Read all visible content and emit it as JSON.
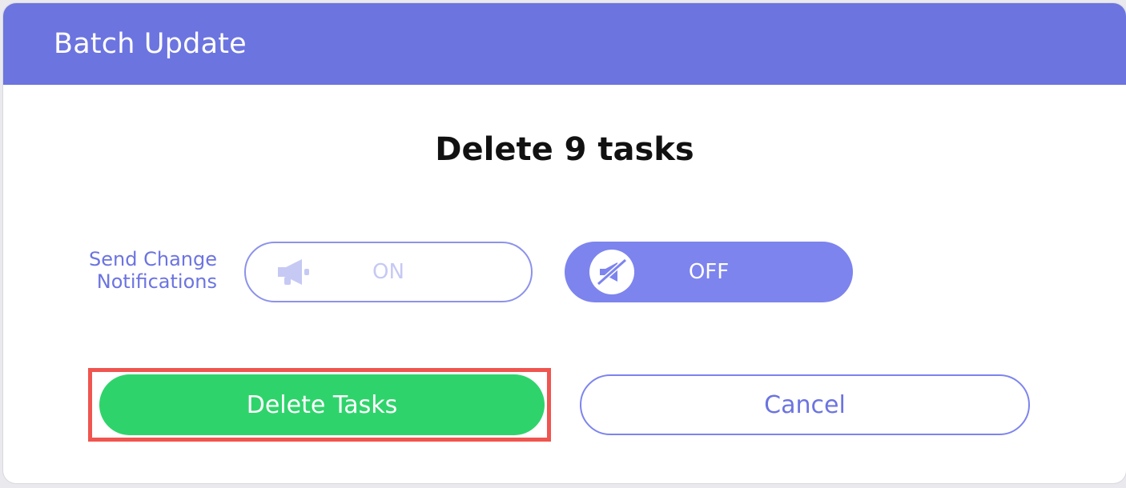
{
  "dialog": {
    "title": "Batch Update",
    "heading": "Delete 9 tasks"
  },
  "notifications": {
    "label_line1": "Send Change",
    "label_line2": "Notifications",
    "on_label": "ON",
    "off_label": "OFF",
    "selected": "OFF",
    "on_icon": "megaphone-icon",
    "off_icon": "megaphone-off-icon"
  },
  "actions": {
    "delete_label": "Delete Tasks",
    "cancel_label": "Cancel"
  },
  "colors": {
    "header": "#6c74e0",
    "accent": "#7d84ee",
    "delete_button": "#2ed46b",
    "highlight": "#f0554f"
  }
}
